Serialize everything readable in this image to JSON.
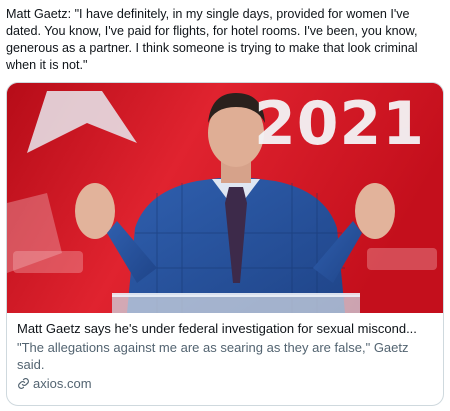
{
  "tweet": {
    "text": "Matt Gaetz: \"I have definitely, in my single days, provided for women I've dated. You know, I've paid for flights, for hotel rooms. I've been, you know, generous as a partner. I think someone is trying to make that look criminal when it is not.\""
  },
  "card": {
    "image": {
      "year": "2021",
      "subject": "man-in-blue-suit-at-podium",
      "background_color": "#d0141f"
    },
    "title": "Matt Gaetz says he's under federal investigation for sexual miscond...",
    "description": "\"The allegations against me are as searing as they are false,\" Gaetz said.",
    "domain": "axios.com",
    "domain_icon": "link-icon"
  }
}
